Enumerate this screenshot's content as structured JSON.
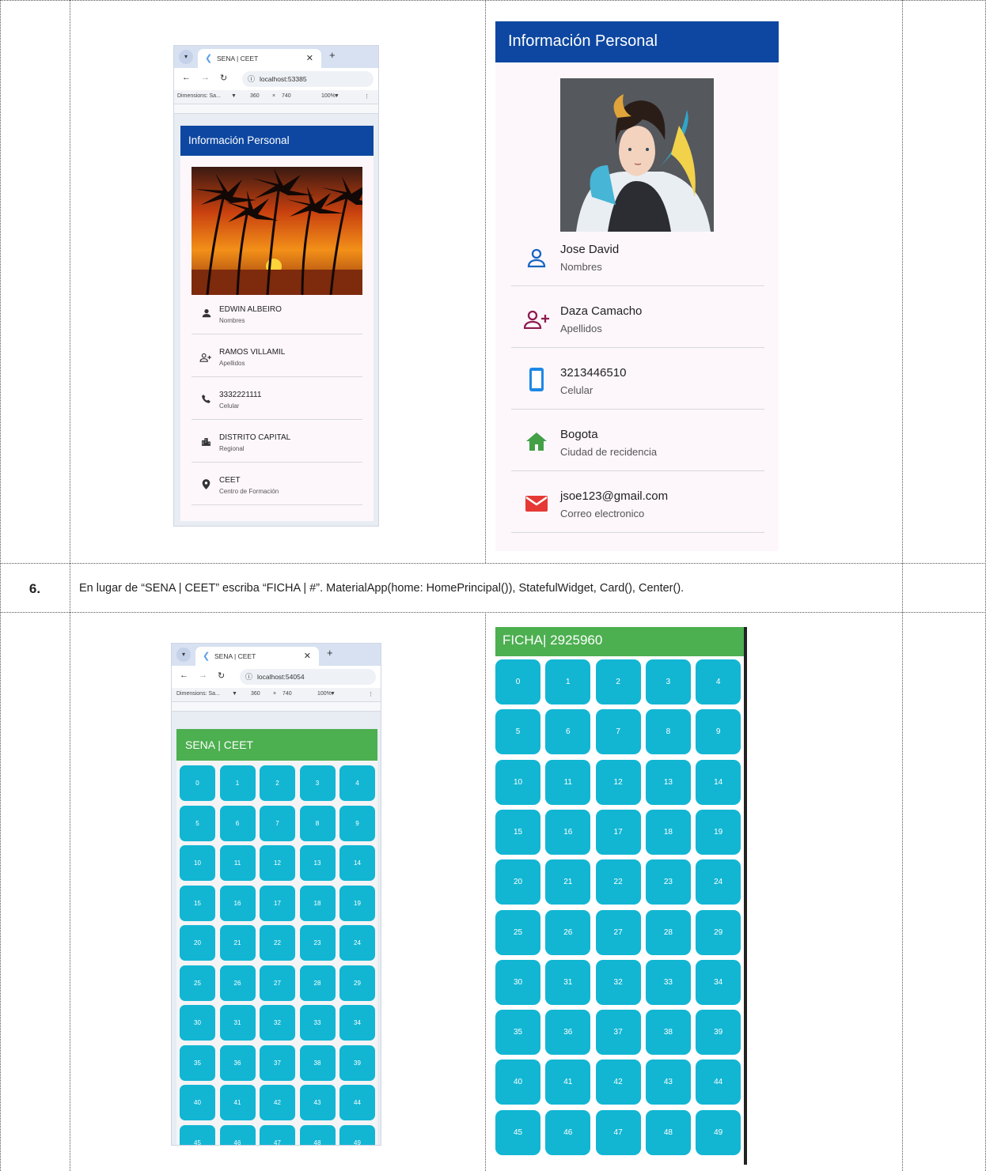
{
  "row6": {
    "number": "6.",
    "instruction": "En lugar de “SENA | CEET” escriba “FICHA | #”. MaterialApp(home: HomePrincipal()), StatefulWidget, Card(), Center()."
  },
  "browser": {
    "url_1": "localhost:53385",
    "url_2": "localhost:54054",
    "tab_title": "SENA | CEET",
    "dimensions_label": "Dimensions: Sa...",
    "width": "360",
    "times": "×",
    "height": "740",
    "zoom": "100%"
  },
  "profile_left": {
    "appbar_title": "Información Personal",
    "items": [
      {
        "title": "EDWIN ALBEIRO",
        "subtitle": "Nombres",
        "icon": "person-icon"
      },
      {
        "title": "RAMOS VILLAMIL",
        "subtitle": "Apellidos",
        "icon": "person-add-icon"
      },
      {
        "title": "3332221111",
        "subtitle": "Celular",
        "icon": "phone-icon"
      },
      {
        "title": "DISTRITO CAPITAL",
        "subtitle": "Regional",
        "icon": "city-icon"
      },
      {
        "title": "CEET",
        "subtitle": "Centro de Formación",
        "icon": "location-pin-icon"
      }
    ]
  },
  "profile_right": {
    "appbar_title": "Información Personal",
    "items": [
      {
        "title": "Jose David",
        "subtitle": "Nombres",
        "icon": "person-outline-icon"
      },
      {
        "title": "Daza Camacho",
        "subtitle": "Apellidos",
        "icon": "person-add-outline-icon"
      },
      {
        "title": "3213446510",
        "subtitle": "Celular",
        "icon": "smartphone-icon"
      },
      {
        "title": "Bogota",
        "subtitle": "Ciudad de recidencia",
        "icon": "home-icon"
      },
      {
        "title": "jsoe123@gmail.com",
        "subtitle": "Correo electronico",
        "icon": "mail-icon"
      }
    ]
  },
  "grid_left": {
    "appbar_title": "SENA | CEET"
  },
  "grid_right": {
    "appbar_title": "FICHA| 2925960"
  },
  "colors": {
    "blue_appbar": "#0d47a1",
    "green_appbar": "#4caf50",
    "tile": "#12b6d3"
  }
}
